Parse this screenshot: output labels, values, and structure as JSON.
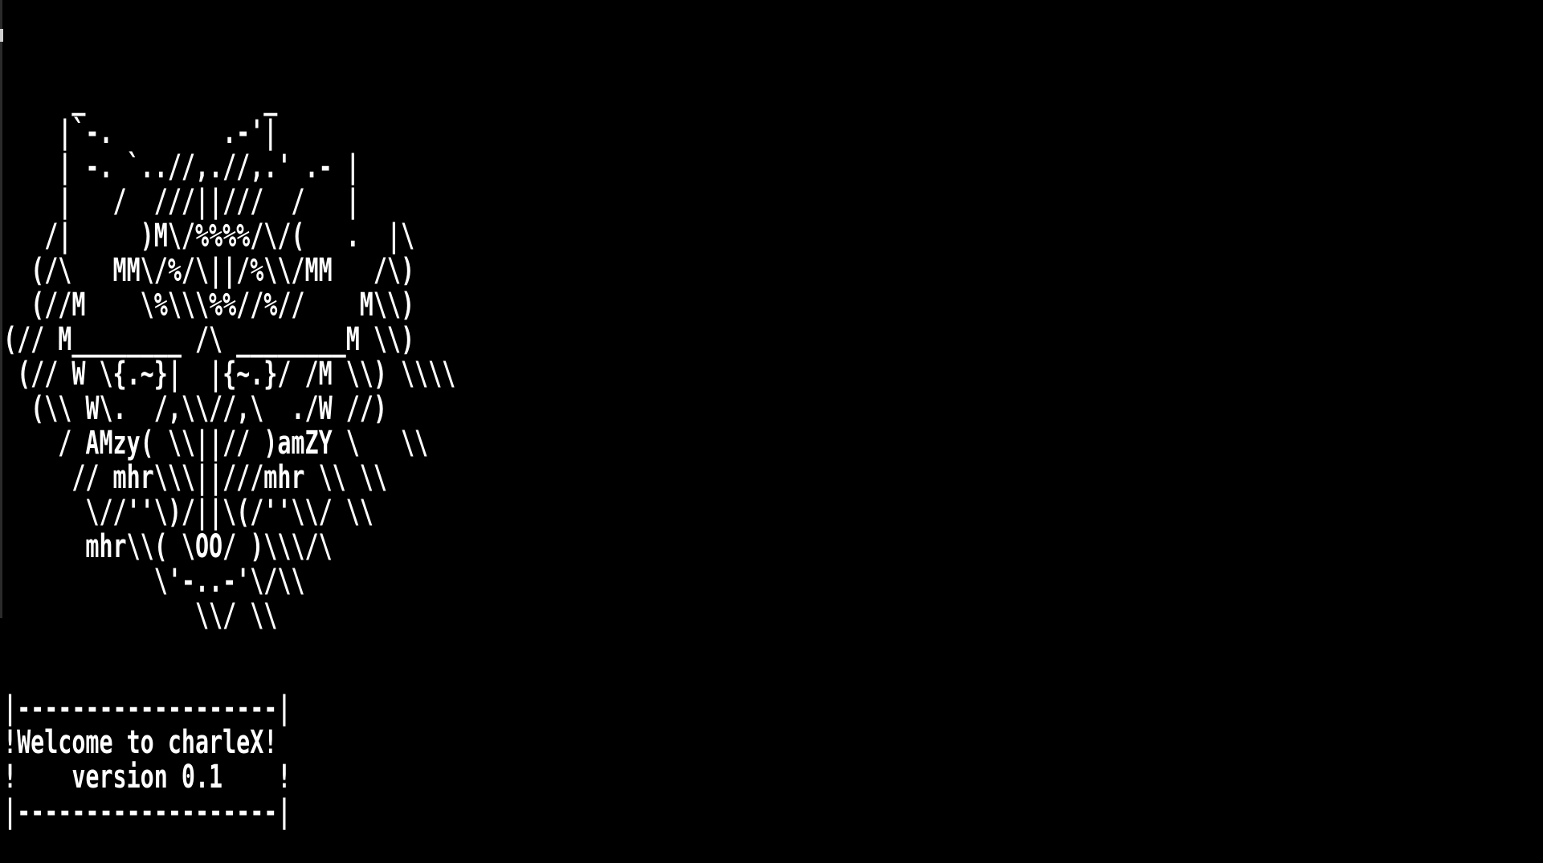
{
  "terminal": {
    "ascii_art": [
      "     _             _",
      "    |`-.        .-'|",
      "    | -. `..//,.//,.' .- |",
      "    |   /  ///||///  /   |",
      "   /|     )M\\/%%%%/\\/(   .  |\\",
      "  (/\\   MM\\/%/\\||/%\\\\/MM   /\\)",
      "  (//M    \\%\\\\\\%%//%//    M\\\\)",
      "(// M________ /\\ ________M \\\\)",
      " (// W \\{.~}|  |{~.}/ /M \\\\) \\\\\\\\",
      "  (\\\\ W\\.  /,\\\\//,\\  ./W //)",
      "    / AMzy( \\\\||// )amZY \\   \\\\",
      "     // mhr\\\\\\||///mhr \\\\ \\\\",
      "      \\//''\\)/||\\(/''\\\\/ \\\\",
      "      mhr\\\\( \\OO/ )\\\\\\/\\",
      "           \\'-..-'\\/\\\\",
      "              \\\\/ \\\\"
    ],
    "banner_lines": [
      "|-------------------|",
      "!Welcome to charleX!",
      "!    version 0.1    !",
      "|-------------------|"
    ]
  },
  "colors": {
    "background": "#000000",
    "foreground": "#ffffff"
  }
}
